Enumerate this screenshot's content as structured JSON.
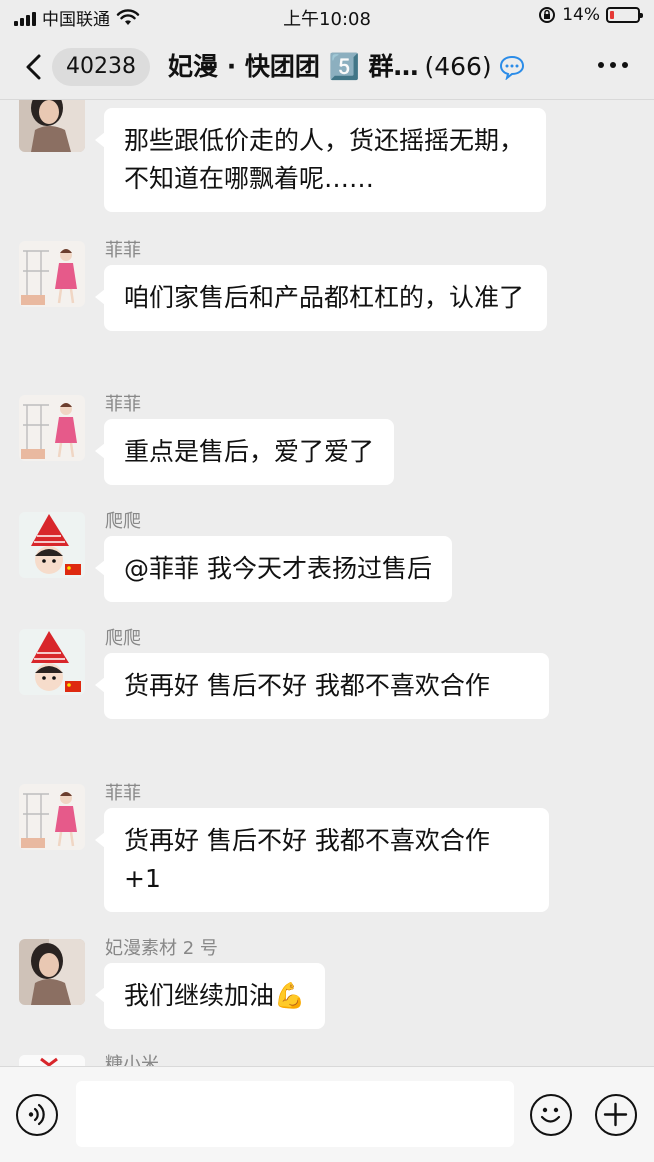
{
  "status_bar": {
    "carrier": "中国联通",
    "time": "上午10:08",
    "battery": "14%",
    "battery_level": 0.14
  },
  "nav": {
    "back_badge": "40238",
    "title": "妃漫 · 快团团 5️⃣ 群…",
    "member_count": "(466)"
  },
  "messages": [
    {
      "sender": "",
      "avatar": "avatar-woman-photo",
      "text": "那些跟低价走的人，货还摇摇无期，不知道在哪飘着呢……"
    },
    {
      "sender": "菲菲",
      "avatar": "avatar-cartoon-girl",
      "text": "咱们家售后和产品都杠杠的，认准了"
    },
    {
      "sender": "菲菲",
      "avatar": "avatar-cartoon-girl",
      "text": "重点是售后，爱了爱了"
    },
    {
      "sender": "爬爬",
      "avatar": "avatar-red-hat",
      "text": "@菲菲 我今天才表扬过售后"
    },
    {
      "sender": "爬爬",
      "avatar": "avatar-red-hat",
      "text": "货再好 售后不好   我都不喜欢合作"
    },
    {
      "sender": "菲菲",
      "avatar": "avatar-cartoon-girl",
      "text": "货再好 售后不好   我都不喜欢合作 +1"
    },
    {
      "sender": "妃漫素材 2 号",
      "avatar": "avatar-woman-photo",
      "text": "我们继续加油💪"
    },
    {
      "sender": "糖小米",
      "avatar": "avatar-partial",
      "text": ""
    }
  ],
  "input_bar": {
    "voice_icon": "voice-icon",
    "emoji_icon": "emoji-icon",
    "plus_icon": "plus-icon"
  }
}
